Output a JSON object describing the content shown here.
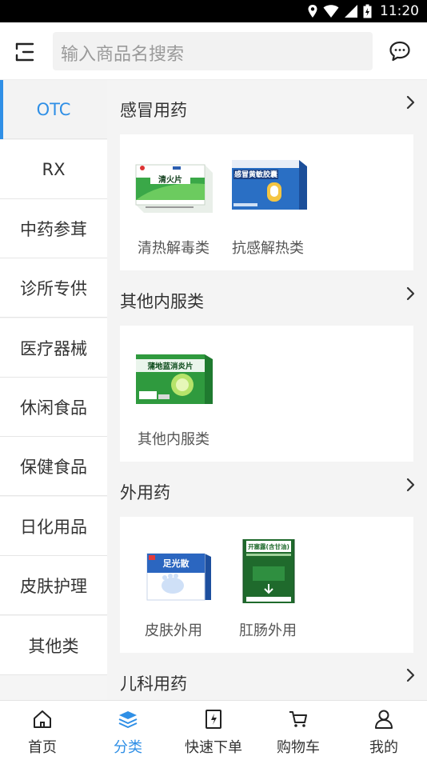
{
  "status_bar": {
    "time": "11:20"
  },
  "search": {
    "placeholder": "输入商品名搜索"
  },
  "sidebar": {
    "items": [
      {
        "label": "OTC",
        "active": true
      },
      {
        "label": "RX"
      },
      {
        "label": "中药参茸"
      },
      {
        "label": "诊所专供"
      },
      {
        "label": "医疗器械"
      },
      {
        "label": "休闲食品"
      },
      {
        "label": "保健食品"
      },
      {
        "label": "日化用品"
      },
      {
        "label": "皮肤护理"
      },
      {
        "label": "其他类"
      }
    ]
  },
  "sections": [
    {
      "title": "感冒用药",
      "products": [
        {
          "name": "清热解毒类",
          "box_text": "清火片"
        },
        {
          "name": "抗感解热类",
          "box_text": "感冒黄敏胶囊"
        }
      ]
    },
    {
      "title": "其他内服类",
      "products": [
        {
          "name": "其他内服类",
          "box_text": "蒲地蓝消炎片"
        }
      ]
    },
    {
      "title": "外用药",
      "products": [
        {
          "name": "皮肤外用",
          "box_text": "足光散"
        },
        {
          "name": "肛肠外用",
          "box_text": "开塞露(含甘油)"
        }
      ]
    },
    {
      "title": "儿科用药",
      "products": []
    }
  ],
  "tabbar": {
    "tabs": [
      {
        "label": "首页",
        "icon": "home-icon"
      },
      {
        "label": "分类",
        "icon": "category-icon",
        "active": true
      },
      {
        "label": "快速下单",
        "icon": "quick-order-icon"
      },
      {
        "label": "购物车",
        "icon": "cart-icon"
      },
      {
        "label": "我的",
        "icon": "user-icon"
      }
    ]
  },
  "colors": {
    "accent": "#2f8fe6",
    "content_bg": "#f4f4f4"
  }
}
